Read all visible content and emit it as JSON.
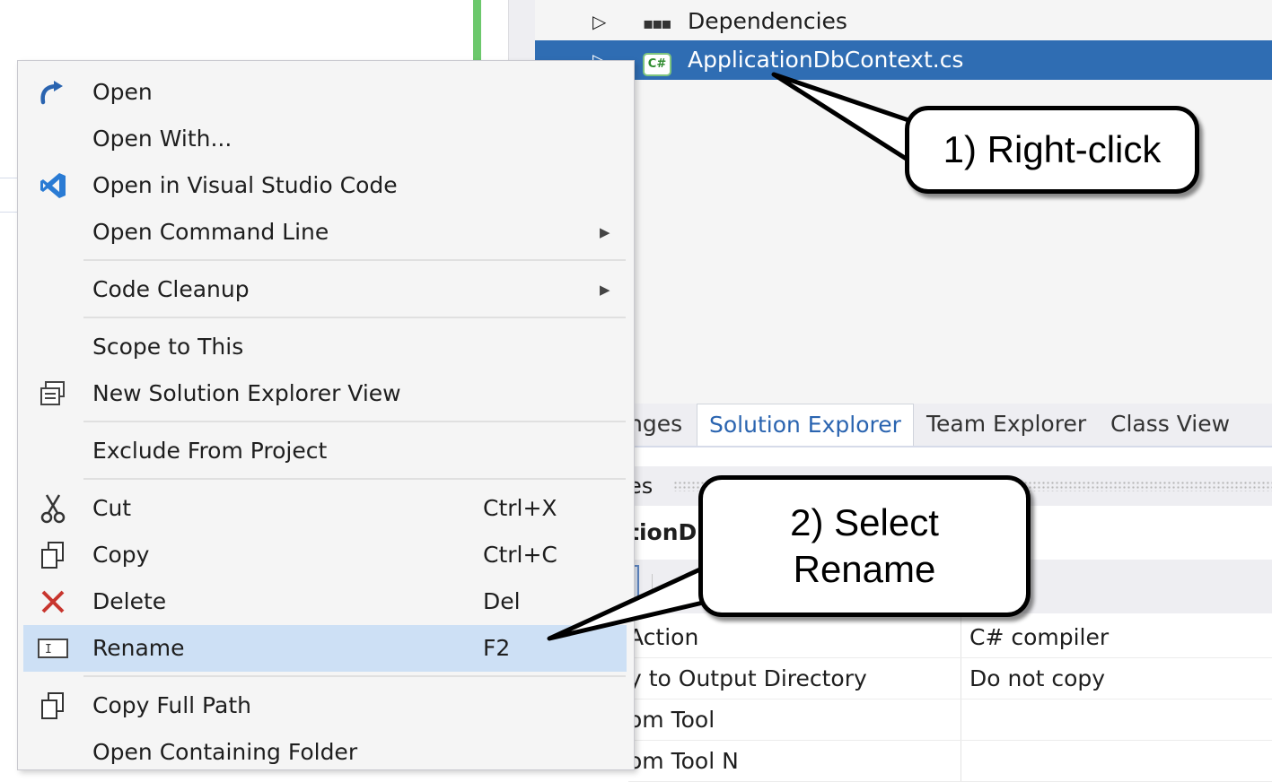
{
  "solution_explorer": {
    "items": [
      {
        "label": "Dependencies",
        "icon": "dependencies-icon",
        "selected": false
      },
      {
        "label": "ApplicationDbContext.cs",
        "icon": "csharp-file-icon",
        "selected": true
      }
    ],
    "tabs": [
      {
        "label": "nges",
        "active": false
      },
      {
        "label": "Solution Explorer",
        "active": true
      },
      {
        "label": "Team Explorer",
        "active": false
      },
      {
        "label": "Class View",
        "active": false
      }
    ]
  },
  "properties": {
    "header_fragment": "es",
    "object_fragment": "tionD",
    "rows": [
      {
        "name": " Action",
        "value": "C# compiler"
      },
      {
        "name": "y to Output Directory",
        "value": "Do not copy"
      },
      {
        "name": "om Tool",
        "value": ""
      },
      {
        "name": "om Tool N",
        "value": ""
      }
    ]
  },
  "context_menu": {
    "items": [
      {
        "label": "Open",
        "shortcut": "",
        "icon": "open-arrow-icon",
        "submenu": false
      },
      {
        "label": "Open With...",
        "shortcut": "",
        "icon": "",
        "submenu": false
      },
      {
        "label": "Open in Visual Studio Code",
        "shortcut": "",
        "icon": "vscode-icon",
        "submenu": false
      },
      {
        "label": "Open Command Line",
        "shortcut": "",
        "icon": "",
        "submenu": true
      },
      {
        "label": "Code Cleanup",
        "shortcut": "",
        "icon": "",
        "submenu": true
      },
      {
        "label": "Scope to This",
        "shortcut": "",
        "icon": "",
        "submenu": false
      },
      {
        "label": "New Solution Explorer View",
        "shortcut": "",
        "icon": "new-explorer-view-icon",
        "submenu": false
      },
      {
        "label": "Exclude From Project",
        "shortcut": "",
        "icon": "",
        "submenu": false
      },
      {
        "label": "Cut",
        "shortcut": "Ctrl+X",
        "icon": "scissors-icon",
        "submenu": false
      },
      {
        "label": "Copy",
        "shortcut": "Ctrl+C",
        "icon": "copy-icon",
        "submenu": false
      },
      {
        "label": "Delete",
        "shortcut": "Del",
        "icon": "delete-x-icon",
        "submenu": false
      },
      {
        "label": "Rename",
        "shortcut": "F2",
        "icon": "rename-icon",
        "submenu": false,
        "highlighted": true
      },
      {
        "label": "Copy Full Path",
        "shortcut": "",
        "icon": "copy-path-icon",
        "submenu": false
      },
      {
        "label": "Open Containing Folder",
        "shortcut": "",
        "icon": "",
        "submenu": false
      }
    ]
  },
  "callouts": {
    "step1": "1) Right-click",
    "step2_line1": "2) Select",
    "step2_line2": "Rename"
  },
  "colors": {
    "selection": "#2f6db3",
    "menu_highlight": "#cde0f5",
    "active_tab_text": "#2a64b0",
    "delete_icon": "#c8352e",
    "vscode_icon": "#2a7bd4",
    "open_icon": "#2a64b0"
  }
}
